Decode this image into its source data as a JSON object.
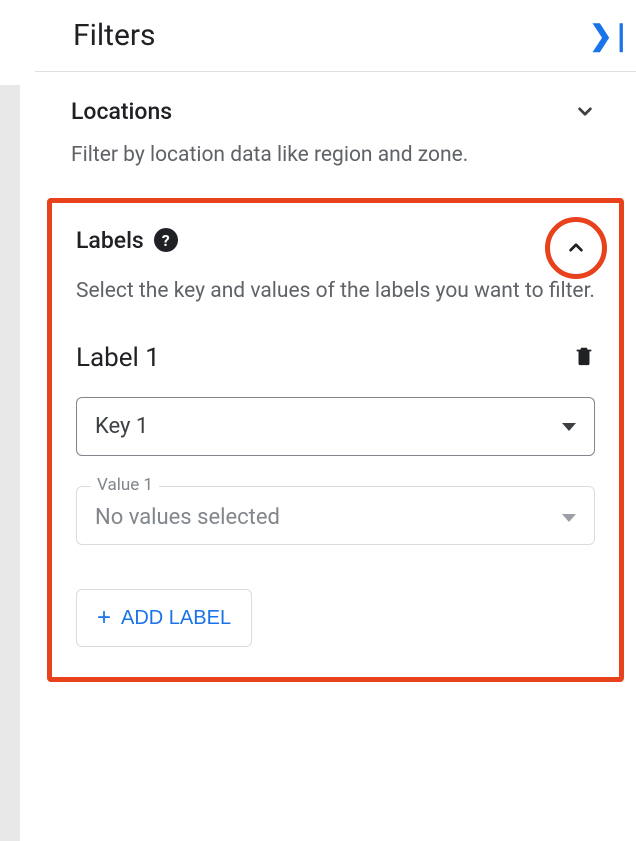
{
  "header": {
    "title": "Filters"
  },
  "locations": {
    "title": "Locations",
    "description": "Filter by location data like region and zone."
  },
  "labels": {
    "title": "Labels",
    "description": "Select the key and values of the labels you want to filter.",
    "item_title": "Label 1",
    "key_select": "Key 1",
    "value_label": "Value 1",
    "value_placeholder": "No values selected",
    "add_button": "ADD LABEL"
  }
}
